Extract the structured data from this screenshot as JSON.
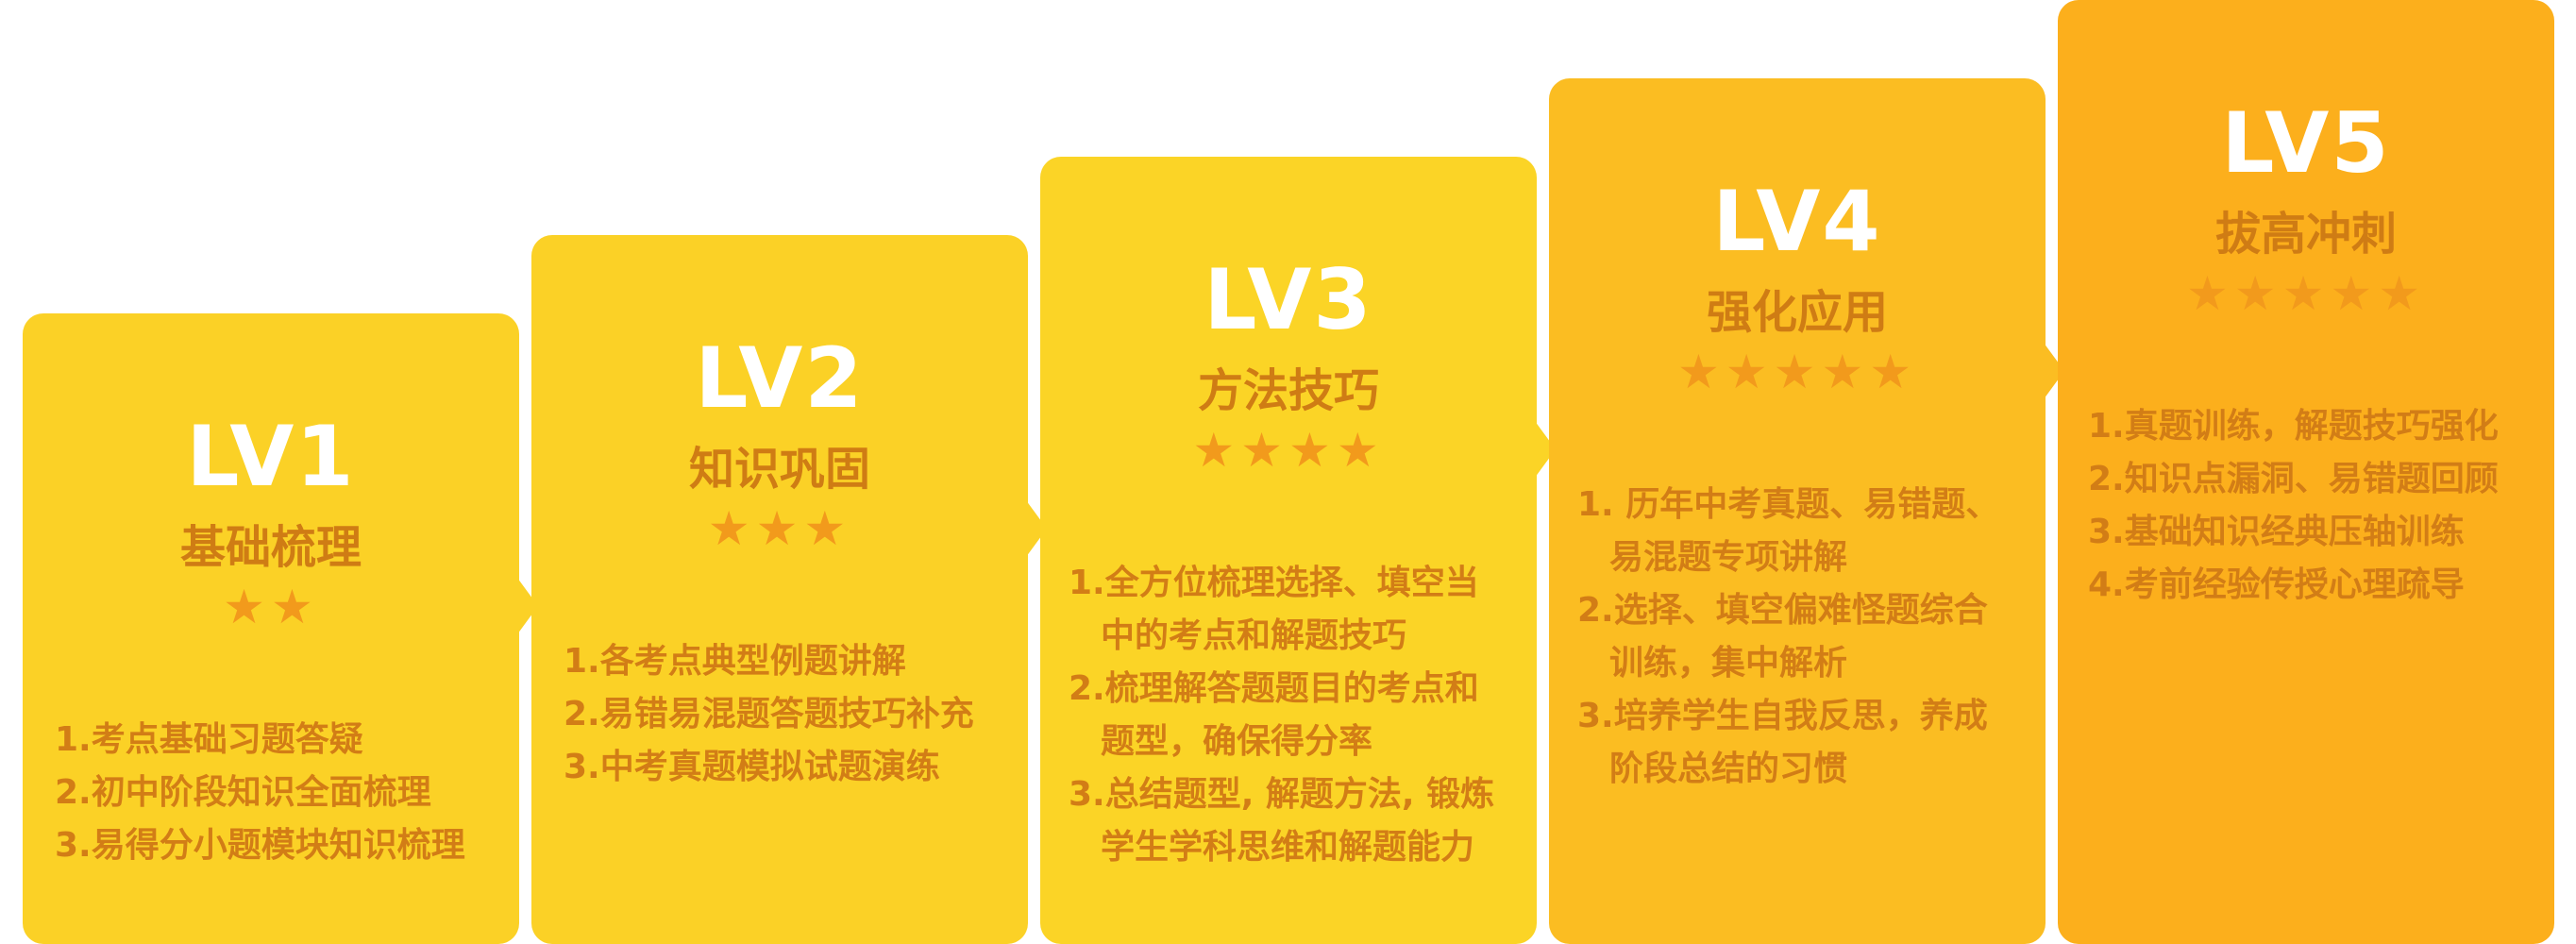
{
  "colors": {
    "card1": "#fbd126",
    "card2": "#fbd126",
    "card3": "#fbd426",
    "card4": "#fbbd22",
    "card5": "#fcaf1c",
    "subtitle": "#cf7c14",
    "item_text": "#d27d16",
    "star": "#f29a1c"
  },
  "levels": [
    {
      "label": "LV1",
      "subtitle": "基础梳理",
      "stars": "★★",
      "star_count": 2,
      "items": [
        {
          "text": "1.考点基础习题答疑"
        },
        {
          "text": "2.初中阶段知识全面梳理"
        },
        {
          "text": "3.易得分小题模块知识梳理"
        }
      ]
    },
    {
      "label": "LV2",
      "subtitle": "知识巩固",
      "stars": "★★★",
      "star_count": 3,
      "items": [
        {
          "text": "1.各考点典型例题讲解"
        },
        {
          "text": "2.易错易混题答题技巧补充"
        },
        {
          "text": "3.中考真题模拟试题演练"
        }
      ]
    },
    {
      "label": "LV3",
      "subtitle": "方法技巧",
      "stars": "★★★★",
      "star_count": 4,
      "items": [
        {
          "text": "1.全方位梳理选择、填空当",
          "cont": "中的考点和解题技巧"
        },
        {
          "text": "2.梳理解答题题目的考点和",
          "cont": "题型，确保得分率"
        },
        {
          "text": "3.总结题型, 解题方法, 锻炼",
          "cont": "学生学科思维和解题能力"
        }
      ]
    },
    {
      "label": "LV4",
      "subtitle": "强化应用",
      "stars": "★★★★★",
      "star_count": 5,
      "items": [
        {
          "text": "1. 历年中考真题、易错题、",
          "cont": "易混题专项讲解"
        },
        {
          "text": "2.选择、填空偏难怪题综合",
          "cont": "训练，集中解析"
        },
        {
          "text": "3.培养学生自我反思，养成",
          "cont": "阶段总结的习惯"
        }
      ]
    },
    {
      "label": "LV5",
      "subtitle": "拔高冲刺",
      "stars": "★★★★★",
      "star_count": 5,
      "items": [
        {
          "text": "1.真题训练，解题技巧强化"
        },
        {
          "text": "2.知识点漏洞、易错题回顾"
        },
        {
          "text": "3.基础知识经典压轴训练"
        },
        {
          "text": "4.考前经验传授心理疏导"
        }
      ]
    }
  ]
}
